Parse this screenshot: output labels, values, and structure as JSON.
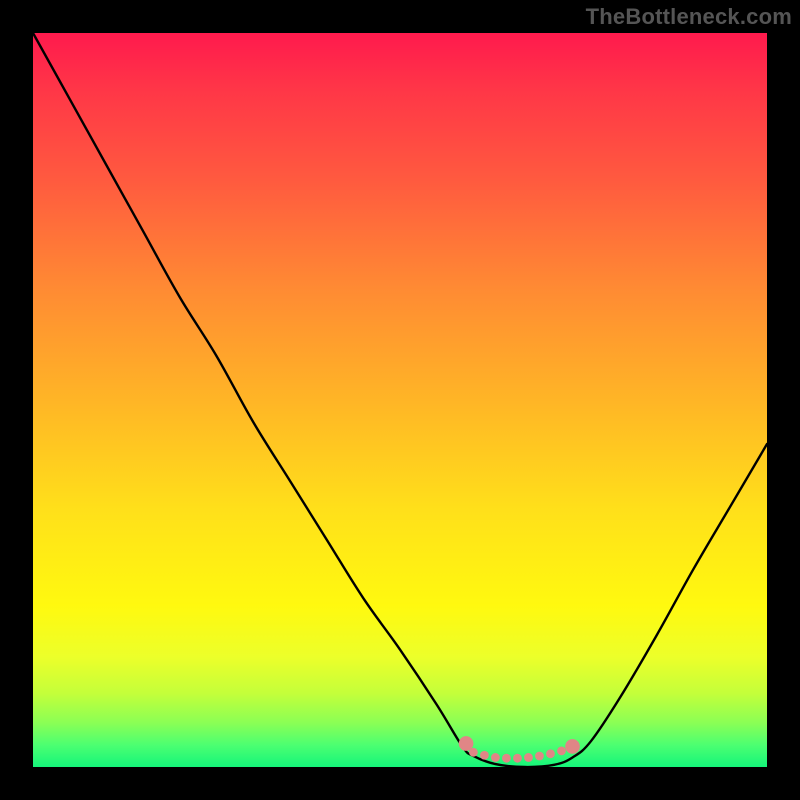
{
  "watermark": "TheBottleneck.com",
  "chart_data": {
    "type": "line",
    "title": "",
    "xlabel": "",
    "ylabel": "",
    "xlim": [
      0,
      1
    ],
    "ylim": [
      0,
      1
    ],
    "series": [
      {
        "name": "curve",
        "x": [
          0.0,
          0.05,
          0.1,
          0.15,
          0.2,
          0.25,
          0.3,
          0.35,
          0.4,
          0.45,
          0.5,
          0.55,
          0.585,
          0.6,
          0.63,
          0.67,
          0.71,
          0.735,
          0.76,
          0.8,
          0.85,
          0.9,
          0.95,
          1.0
        ],
        "values": [
          1.0,
          0.91,
          0.82,
          0.73,
          0.64,
          0.56,
          0.47,
          0.39,
          0.31,
          0.23,
          0.16,
          0.085,
          0.028,
          0.015,
          0.004,
          0.0,
          0.003,
          0.013,
          0.035,
          0.095,
          0.18,
          0.27,
          0.355,
          0.44
        ]
      }
    ],
    "markers": [
      {
        "name": "left-dot",
        "x": 0.59,
        "y": 0.032,
        "r": 0.01,
        "color": "#e08686"
      },
      {
        "name": "right-dot",
        "x": 0.735,
        "y": 0.028,
        "r": 0.01,
        "color": "#e08686"
      }
    ],
    "dotted_segment": {
      "color": "#e08686",
      "points_x": [
        0.6,
        0.615,
        0.63,
        0.645,
        0.66,
        0.675,
        0.69,
        0.705,
        0.72
      ],
      "points_y": [
        0.02,
        0.016,
        0.013,
        0.012,
        0.012,
        0.013,
        0.015,
        0.018,
        0.022
      ],
      "r": 0.006
    },
    "gradient_stops": [
      {
        "pos": 0.0,
        "color": "#ff1a4d"
      },
      {
        "pos": 0.5,
        "color": "#ffe01a"
      },
      {
        "pos": 1.0,
        "color": "#15f57a"
      }
    ]
  }
}
